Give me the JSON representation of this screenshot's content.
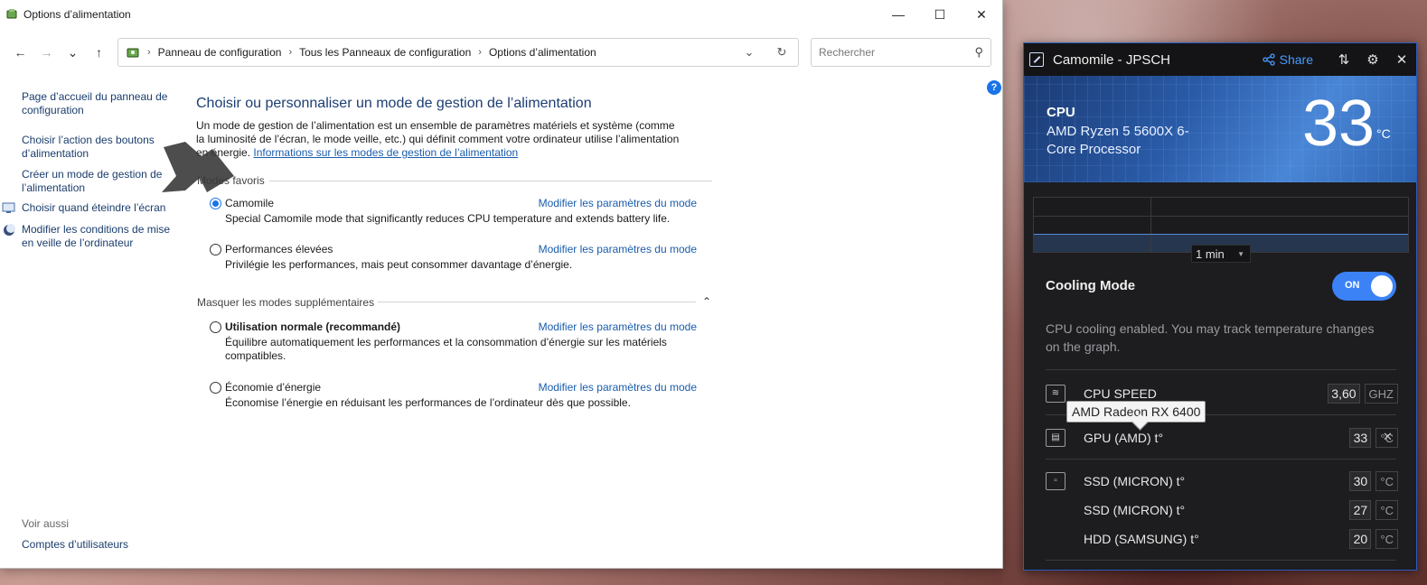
{
  "window": {
    "title": "Options d’alimentation",
    "minimize": "—",
    "maximize": "☐",
    "close": "✕"
  },
  "address": {
    "back": "←",
    "forward": "→",
    "recent": "⌄",
    "up": "↑",
    "crumbs": [
      "Panneau de configuration",
      "Tous les Panneaux de configuration",
      "Options d’alimentation"
    ],
    "dropdown": "⌄",
    "refresh": "↻",
    "search_placeholder": "Rechercher",
    "search_icon": "⚲"
  },
  "help": "?",
  "leftnav": {
    "items": [
      "Page d’accueil du panneau de configuration",
      "Choisir l’action des boutons d’alimentation",
      "Créer un mode de gestion de l’alimentation",
      "Choisir quand éteindre l’écran",
      "Modifier les conditions de mise en veille de l’ordinateur"
    ],
    "see_also": "Voir aussi",
    "user_accounts": "Comptes d’utilisateurs"
  },
  "main": {
    "heading": "Choisir ou personnaliser un mode de gestion de l’alimentation",
    "description": "Un mode de gestion de l’alimentation est un ensemble de paramètres matériels et système (comme la luminosité de l’écran, le mode veille, etc.) qui définit comment votre ordinateur utilise l’alimentation en énergie.",
    "info_link": "Informations sur les modes de gestion de l’alimentation",
    "favorites_title": "Modes favoris",
    "more_title": "Masquer les modes supplémentaires",
    "collapse_icon": "⌃",
    "plans": [
      {
        "name": "Camomile",
        "desc": "Special Camomile mode that significantly reduces CPU temperature and extends battery life.",
        "link": "Modifier les paramètres du mode",
        "selected": true
      },
      {
        "name": "Performances élevées",
        "desc": "Privilégie les performances, mais peut consommer davantage d’énergie.",
        "link": "Modifier les paramètres du mode",
        "selected": false
      },
      {
        "name": "Utilisation normale (recommandé)",
        "desc": "Équilibre automatiquement les performances et la consommation d’énergie sur les matériels compatibles.",
        "link": "Modifier les paramètres du mode",
        "selected": false
      },
      {
        "name": "Économie d’énergie",
        "desc": "Économise l’énergie en réduisant les performances de l’ordinateur dès que possible.",
        "link": "Modifier les paramètres du mode",
        "selected": false
      }
    ]
  },
  "camomile": {
    "title": "Camomile - JPSCH",
    "share": "Share",
    "settings_icon": "⚙",
    "sliders_icon": "⇅",
    "close": "✕",
    "cpu_label": "CPU",
    "cpu_model": "AMD Ryzen 5 5600X 6-Core Processor",
    "cpu_temp": "33",
    "cpu_unit": "°C",
    "range": "1 min",
    "range_caret": "▼",
    "cooling_title": "Cooling Mode",
    "toggle": "ON",
    "cooling_desc": "CPU cooling enabled. You may track temperature changes on the graph.",
    "tooltip": "AMD Radeon RX 6400",
    "metrics": [
      {
        "label": "CPU SPEED",
        "value": "3,60",
        "unit": "GHZ"
      },
      {
        "label": "GPU (AMD) t°",
        "value": "33",
        "unit": "°C"
      },
      {
        "label": "SSD (MICRON) t°",
        "value": "30",
        "unit": "°C"
      },
      {
        "label": "SSD (MICRON) t°",
        "value": "27",
        "unit": "°C"
      },
      {
        "label": "HDD (SAMSUNG) t°",
        "value": "20",
        "unit": "°C"
      }
    ],
    "remove": "✕"
  },
  "colors": {
    "accent": "#1a73e8",
    "link": "#1a5dad",
    "camomile_accent": "#3b82f6"
  }
}
